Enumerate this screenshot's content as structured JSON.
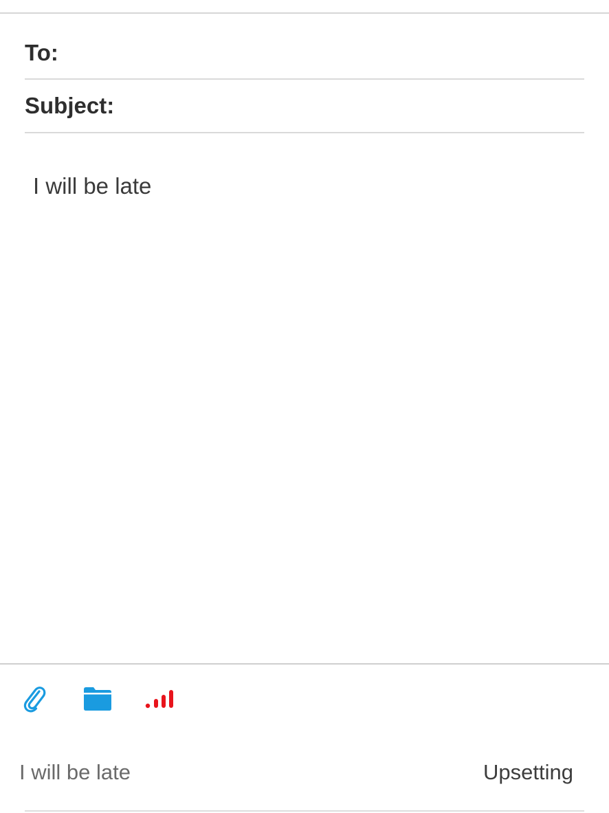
{
  "compose": {
    "to_label": "To:",
    "to_value": "",
    "subject_label": "Subject:",
    "subject_value": "",
    "body": "I will be late"
  },
  "toolbar": {
    "icons": [
      "paperclip-icon",
      "folder-icon",
      "signal-bars-icon"
    ],
    "colors": {
      "accent_blue": "#1a9be0",
      "signal_red": "#e8141c"
    }
  },
  "suggestion": {
    "text": "I will be late",
    "tone": "Upsetting"
  }
}
